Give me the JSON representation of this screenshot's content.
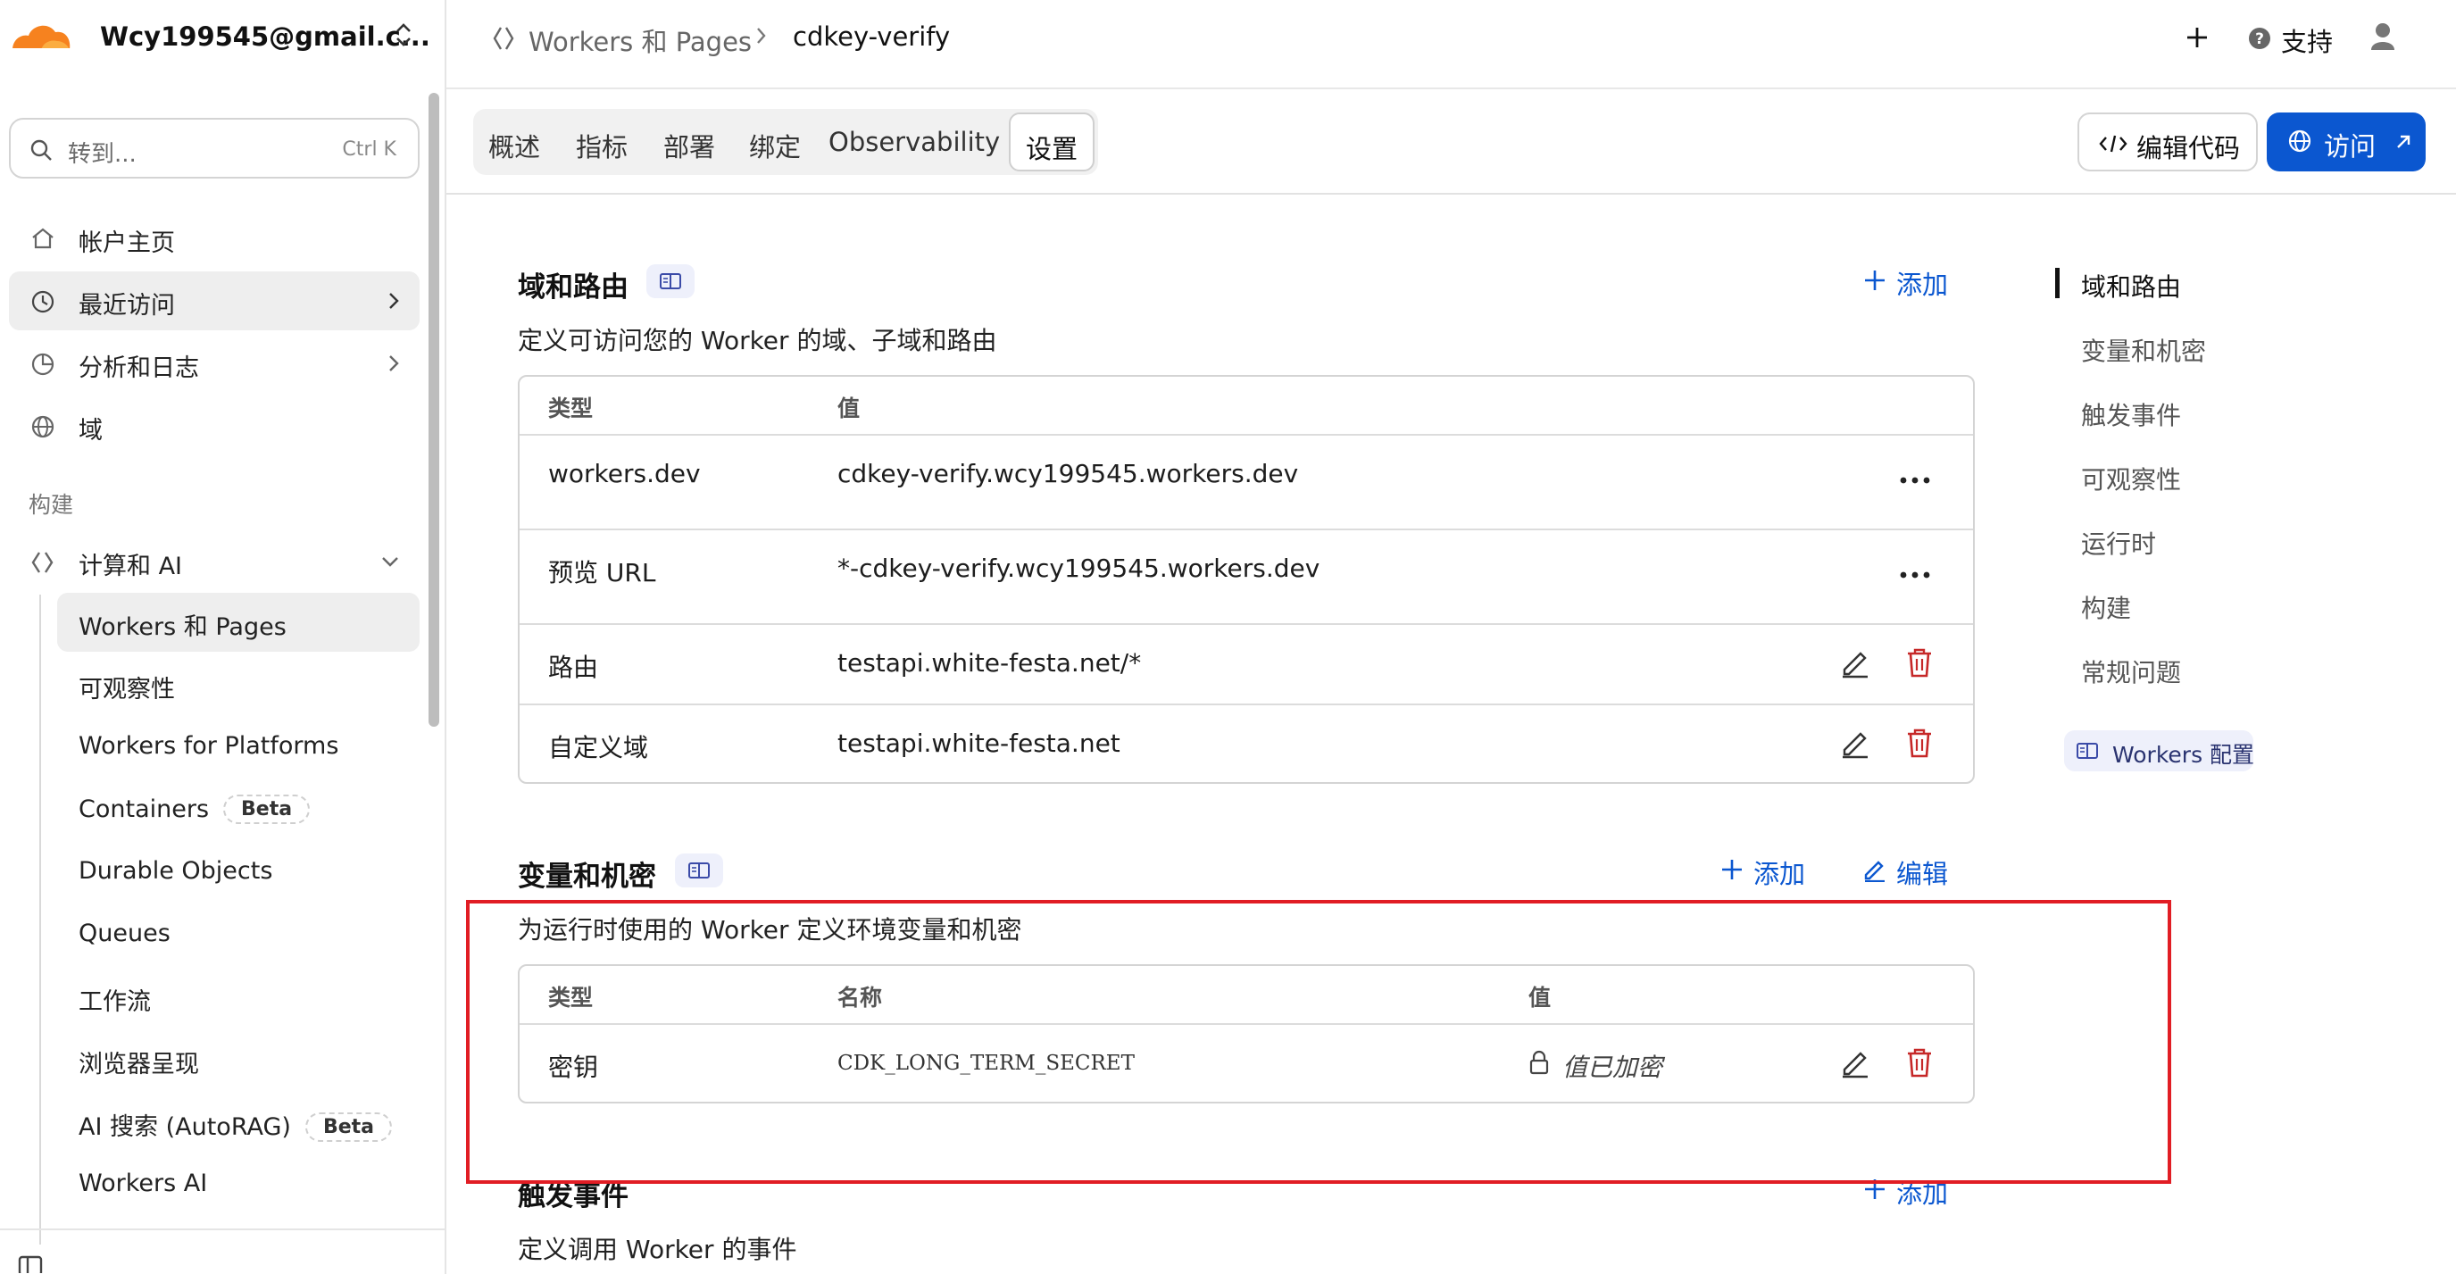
{
  "account": {
    "name": "Wcy199545@gmail.c..."
  },
  "search": {
    "placeholder": "转到...",
    "shortcut": "Ctrl K"
  },
  "sidebar": {
    "items": [
      {
        "label": "帐户主页",
        "icon": "home-icon"
      },
      {
        "label": "最近访问",
        "icon": "clock-icon"
      },
      {
        "label": "分析和日志",
        "icon": "chart-pie-icon"
      },
      {
        "label": "域",
        "icon": "globe-icon"
      }
    ],
    "section_build": "构建",
    "compute_group": {
      "label": "计算和 AI",
      "icon": "workers-icon"
    },
    "sub_items": [
      {
        "label": "Workers 和 Pages"
      },
      {
        "label": "可观察性"
      },
      {
        "label": "Workers for Platforms"
      },
      {
        "label": "Containers",
        "badge": "Beta"
      },
      {
        "label": "Durable Objects"
      },
      {
        "label": "Queues"
      },
      {
        "label": "工作流"
      },
      {
        "label": "浏览器呈现"
      },
      {
        "label": "AI 搜索 (AutoRAG)",
        "badge": "Beta"
      },
      {
        "label": "Workers AI"
      }
    ]
  },
  "breadcrumb": {
    "parent": "Workers 和 Pages",
    "current": "cdkey-verify"
  },
  "header": {
    "support_label": "支持"
  },
  "tabs": [
    {
      "label": "概述"
    },
    {
      "label": "指标"
    },
    {
      "label": "部署"
    },
    {
      "label": "绑定"
    },
    {
      "label": "Observability"
    },
    {
      "label": "设置"
    }
  ],
  "actions": {
    "edit_code": "编辑代码",
    "visit": "访问"
  },
  "domains_section": {
    "title": "域和路由",
    "add_label": "添加",
    "description": "定义可访问您的 Worker 的域、子域和路由",
    "columns": [
      "类型",
      "值"
    ],
    "rows": [
      {
        "type": "workers.dev",
        "value": "cdkey-verify.wcy199545.workers.dev"
      },
      {
        "type": "预览 URL",
        "value": "*-cdkey-verify.wcy199545.workers.dev"
      },
      {
        "type": "路由",
        "value": "testapi.white-festa.net/*"
      },
      {
        "type": "自定义域",
        "value": "testapi.white-festa.net"
      }
    ]
  },
  "variables_section": {
    "title": "变量和机密",
    "add_label": "添加",
    "edit_label": "编辑",
    "description": "为运行时使用的 Worker 定义环境变量和机密",
    "columns": [
      "类型",
      "名称",
      "值"
    ],
    "rows": [
      {
        "type": "密钥",
        "name": "CDK_LONG_TERM_SECRET",
        "value": "值已加密"
      }
    ]
  },
  "triggers_section": {
    "title": "触发事件",
    "add_label": "添加",
    "description": "定义调用 Worker 的事件"
  },
  "toc": {
    "items": [
      "域和路由",
      "变量和机密",
      "触发事件",
      "可观察性",
      "运行时",
      "构建",
      "常规问题"
    ],
    "docs_badge": "Workers 配置"
  },
  "colors": {
    "accent": "#0b57d0",
    "danger": "#c62828",
    "highlight": "#e11d24",
    "brand": "#f6821f"
  }
}
